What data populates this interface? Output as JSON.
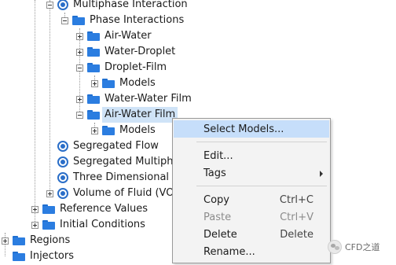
{
  "tree": {
    "multiphase_interaction": "Multiphase Interaction",
    "phase_interactions": "Phase Interactions",
    "air_water": "Air-Water",
    "water_droplet": "Water-Droplet",
    "droplet_film": "Droplet-Film",
    "droplet_film_models": "Models",
    "water_water_film": "Water-Water Film",
    "air_water_film": "Air-Water Film",
    "air_water_film_models": "Models",
    "segregated_flow": "Segregated Flow",
    "segregated_multiphase": "Segregated Multiphase",
    "three_dimensional": "Three Dimensional",
    "volume_of_fluid": "Volume of Fluid (VOF)",
    "reference_values": "Reference Values",
    "initial_conditions": "Initial Conditions",
    "regions": "Regions",
    "injectors": "Injectors"
  },
  "context_menu": {
    "select_models": "Select Models...",
    "edit": "Edit...",
    "tags": "Tags",
    "copy": "Copy",
    "copy_shortcut": "Ctrl+C",
    "paste": "Paste",
    "paste_shortcut": "Ctrl+V",
    "delete": "Delete",
    "delete_shortcut": "Delete",
    "rename": "Rename..."
  },
  "watermark": {
    "text": "CFD之道"
  },
  "colors": {
    "selection": "#cfe3f7",
    "menu_highlight": "#c6defa",
    "folder": "#2b7de0",
    "model_icon": "#2a6ec8"
  }
}
